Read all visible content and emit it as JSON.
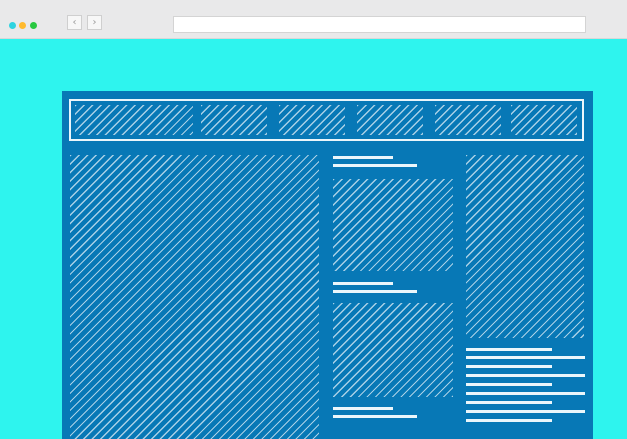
{
  "browser": {
    "title": "",
    "controls": [
      {
        "name": "close-dot",
        "color": "#2fd3e0"
      },
      {
        "name": "minimize-dot",
        "color": "#ffba2e"
      },
      {
        "name": "maximize-dot",
        "color": "#28c840"
      }
    ],
    "nav": {
      "back_glyph": "‹",
      "forward_glyph": "›"
    },
    "address_bar": {
      "value": ""
    }
  },
  "colors": {
    "viewport_background": "#2ef4ee",
    "wireframe_blue": "#0778b6",
    "wireframe_line": "#eaf6fb"
  },
  "wireframe": {
    "header": {
      "logo_placeholder": "hatched-block",
      "nav_items": [
        "nav-placeholder-1",
        "nav-placeholder-2",
        "nav-placeholder-3",
        "nav-placeholder-4",
        "nav-placeholder-5"
      ]
    },
    "hero_placeholder": "hatched-block",
    "middle_column": {
      "cards": 3
    },
    "right_column": {
      "image_placeholder": "hatched-block",
      "text_lines": 8
    }
  }
}
